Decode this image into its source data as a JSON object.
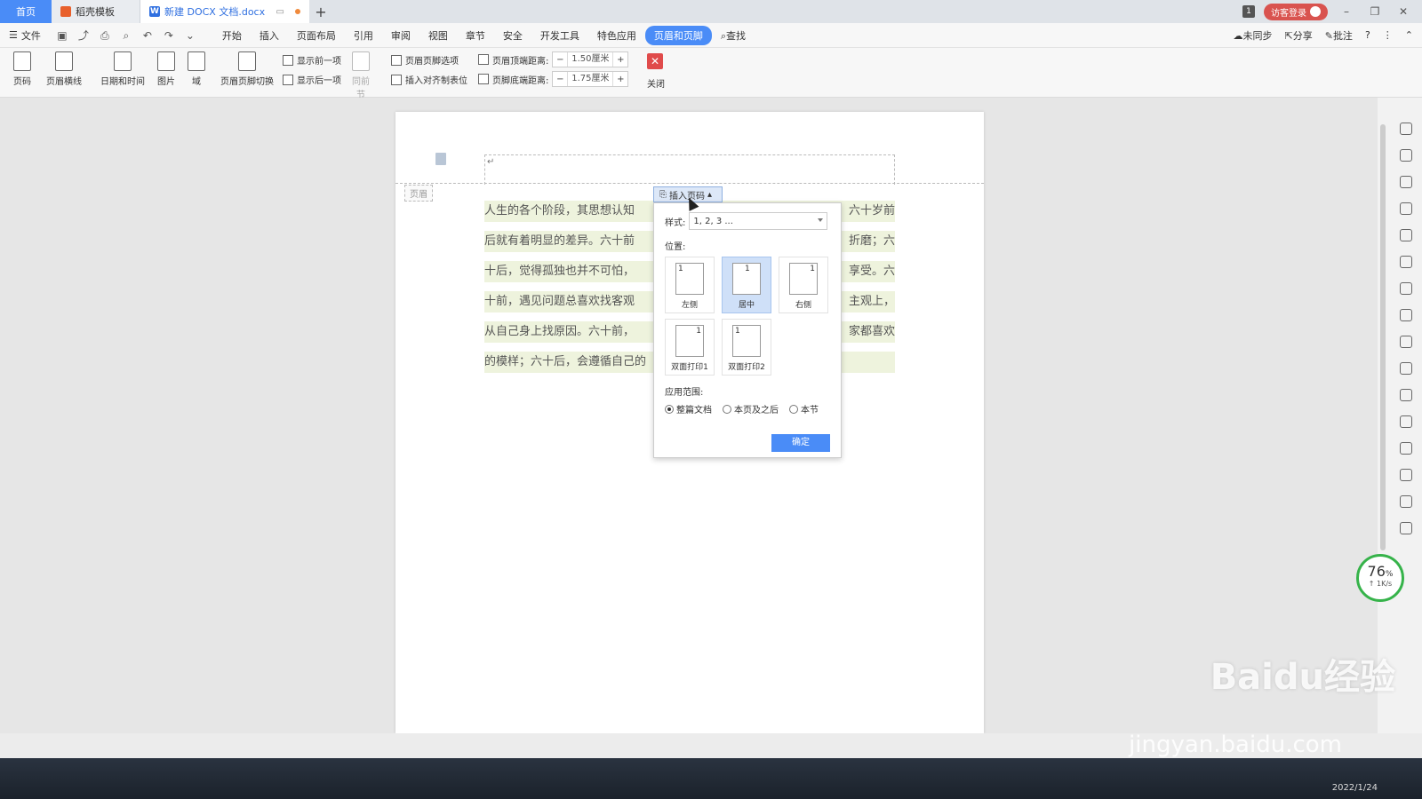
{
  "tabs": {
    "home": "首页",
    "template": "稻壳模板",
    "document": "新建 DOCX 文档.docx",
    "add": "+"
  },
  "window": {
    "badge": "1",
    "login": "访客登录"
  },
  "menubar": {
    "file": "文件",
    "items": [
      "开始",
      "插入",
      "页面布局",
      "引用",
      "审阅",
      "视图",
      "章节",
      "安全",
      "开发工具",
      "特色应用",
      "页眉和页脚",
      "查找"
    ],
    "active_index": 10,
    "right": [
      "未同步",
      "分享",
      "批注",
      "?"
    ]
  },
  "ribbon": {
    "page_number": "页码",
    "header_line": "页眉横线",
    "date_time": "日期和时间",
    "picture": "图片",
    "field": "域",
    "switch_hf": "页眉页脚切换",
    "show_prev": "显示前一项",
    "show_next": "显示后一项",
    "same_as_prev": "同前节",
    "hf_options": "页眉页脚选项",
    "insert_align_tab": "插入对齐制表位",
    "top_distance_label": "页眉顶端距离:",
    "top_distance_value": "1.50厘米",
    "bottom_distance_label": "页脚底端距离:",
    "bottom_distance_value": "1.75厘米",
    "close": "关闭"
  },
  "document": {
    "header_label": "页眉",
    "header_para_mark": "↵",
    "lines": [
      "人生的各个阶段，其思想认知",
      "后就有着明显的差异。六十前",
      "十后，觉得孤独也并不可怕，",
      "十前，遇见问题总喜欢找客观",
      "从自己身上找原因。六十前，",
      "的模样；六十后，会遵循自己的"
    ],
    "right_fragments": [
      "六十岁前",
      "折磨；六",
      "享受。六",
      "主观上，",
      "家都喜欢",
      ""
    ]
  },
  "popup": {
    "trigger": "插入页码",
    "style_label": "样式:",
    "style_value": "1, 2, 3 ...",
    "position_label": "位置:",
    "positions": [
      "左侧",
      "居中",
      "右侧",
      "双面打印1",
      "双面打印2"
    ],
    "selected_position": 1,
    "scope_label": "应用范围:",
    "scope_options": [
      "整篇文档",
      "本页及之后",
      "本节"
    ],
    "selected_scope": 0,
    "ok": "确定"
  },
  "speed": {
    "percent": "76",
    "unit": "%",
    "rate": "↑ 1K/s"
  },
  "taskbar": {
    "date": "2022/1/24"
  },
  "watermark": {
    "brand": "Baidu经验",
    "url": "jingyan.baidu.com"
  }
}
